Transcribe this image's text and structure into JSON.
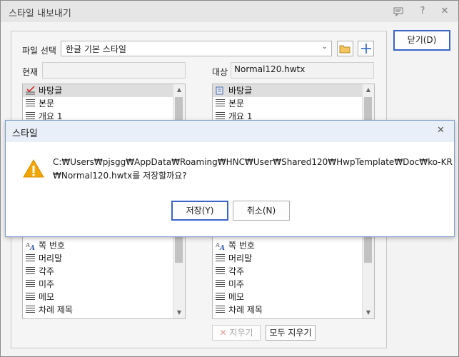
{
  "window": {
    "title": "스타일 내보내기",
    "help": "?",
    "close": "✕"
  },
  "buttons": {
    "close_label": "닫기(D)",
    "delete_label": "지우기",
    "delete_all_label": "모두 지우기"
  },
  "file": {
    "label": "파일 선택",
    "value": "한글 기본 스타일"
  },
  "current": {
    "label": "현재",
    "value": ""
  },
  "target": {
    "label": "대상",
    "value": "Normal120.hwtx"
  },
  "left_list": {
    "top_items": [
      "바탕글",
      "본문",
      "개요 1"
    ],
    "bottom_items": [
      "쪽 번호",
      "머리말",
      "각주",
      "미주",
      "메모",
      "차례 제목"
    ]
  },
  "right_list": {
    "top_items": [
      "바탕글",
      "본문",
      "개요 1"
    ],
    "bottom_items": [
      "쪽 번호",
      "머리말",
      "각주",
      "미주",
      "메모",
      "차례 제목"
    ]
  },
  "dialog": {
    "title": "스타일",
    "message_line1": "C:₩Users₩pjsgg₩AppData₩Roaming₩HNC₩User₩Shared120₩HwpTemplate₩Doc₩ko-KR",
    "message_line2": "₩Normal120.hwtx를 저장할까요?",
    "save_label": "저장(Y)",
    "cancel_label": "취소(N)"
  },
  "colors": {
    "accent": "#3b64c8",
    "warning": "#f0a500",
    "check": "#d62b2b"
  }
}
